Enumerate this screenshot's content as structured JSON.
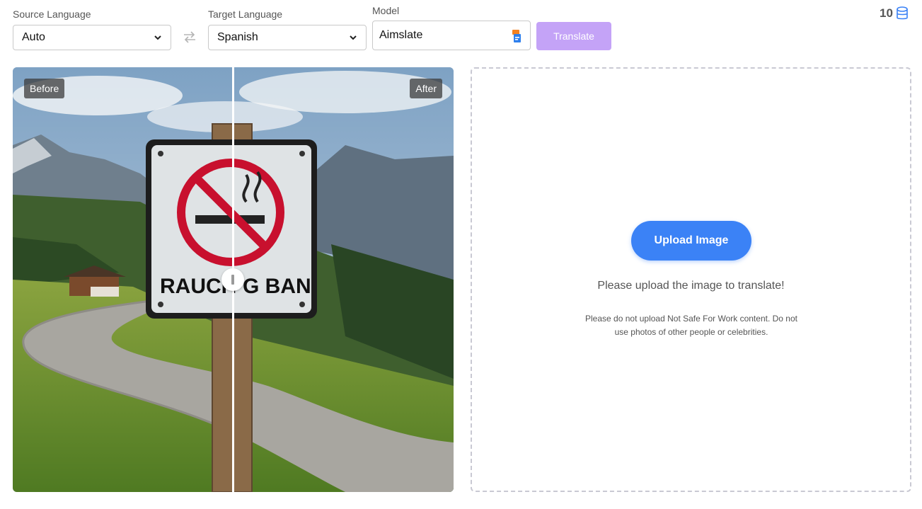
{
  "toolbar": {
    "source_label": "Source Language",
    "source_value": "Auto",
    "target_label": "Target Language",
    "target_value": "Spanish",
    "model_label": "Model",
    "model_value": "Aimslate",
    "translate_label": "Translate"
  },
  "credits": {
    "count": "10",
    "icon": "database-icon"
  },
  "preview": {
    "before_label": "Before",
    "after_label": "After",
    "sign_text_left": "RAUCH",
    "sign_text_right": "G BAN",
    "slider_fraction": 0.5
  },
  "upload": {
    "button_label": "Upload Image",
    "hint": "Please upload the image to translate!",
    "warning": "Please do not upload Not Safe For Work content. Do not use photos of other people or celebrities."
  },
  "colors": {
    "accent": "#3b82f6",
    "translate_button": "#c4a3f7",
    "sign_red": "#c8102e"
  }
}
